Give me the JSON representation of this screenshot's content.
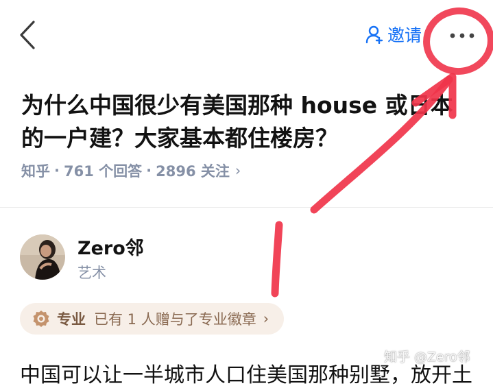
{
  "header": {
    "invite_label": "邀请"
  },
  "question": {
    "title": "为什么中国很少有美国那种 house 或日本的一户建？大家基本都住楼房？",
    "source": "知乎",
    "answers": "761 个回答",
    "followers": "2896 关注",
    "separator": "·",
    "chevron": "›"
  },
  "answer": {
    "author_name": "Zero邻",
    "author_tag": "艺术",
    "badge_title": "专业",
    "badge_text": "已有 1 人赠与了专业徽章",
    "badge_chevron": "›",
    "excerpt": "中国可以让一半城市人口住美国那种别墅，放开土"
  },
  "watermark": {
    "text": "知乎 @Zero邻"
  },
  "colors": {
    "accent_blue": "#1772f6",
    "annotation_red": "#f0344a",
    "meta_gray": "#8590a6",
    "badge_bg": "#f7efe8"
  },
  "icons": {
    "back": "chevron-left-icon",
    "invite": "person-add-icon",
    "more": "more-dots-icon",
    "badge": "medal-icon"
  }
}
